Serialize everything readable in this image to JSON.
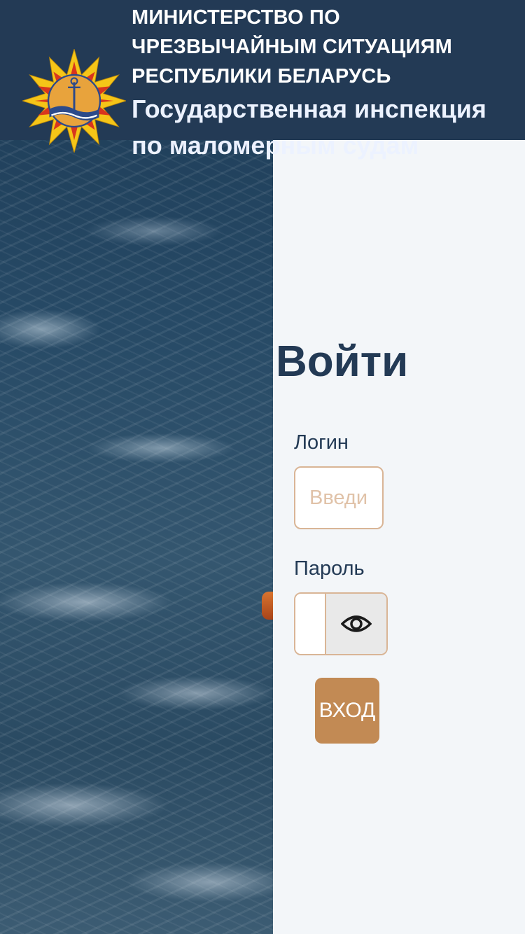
{
  "header": {
    "org_lines": [
      "МИНИСТЕРСТВО ПО",
      "ЧРЕЗВЫЧАЙНЫМ СИТУАЦИЯМ",
      "РЕСПУБЛИКИ БЕЛАРУСЬ"
    ],
    "service_name": "Государственная инспекция по маломерным судам",
    "emblem_icon": "mchs-star-emblem-icon"
  },
  "login": {
    "title": "Войти",
    "login_label": "Логин",
    "login_placeholder": "Введи",
    "password_label": "Пароль",
    "toggle_icon": "eye-icon",
    "submit_label": "ВХОД"
  },
  "colors": {
    "header_bg": "#233a55",
    "panel_bg": "#f3f6f9",
    "accent": "#c28a54",
    "input_border": "#d9b596"
  }
}
